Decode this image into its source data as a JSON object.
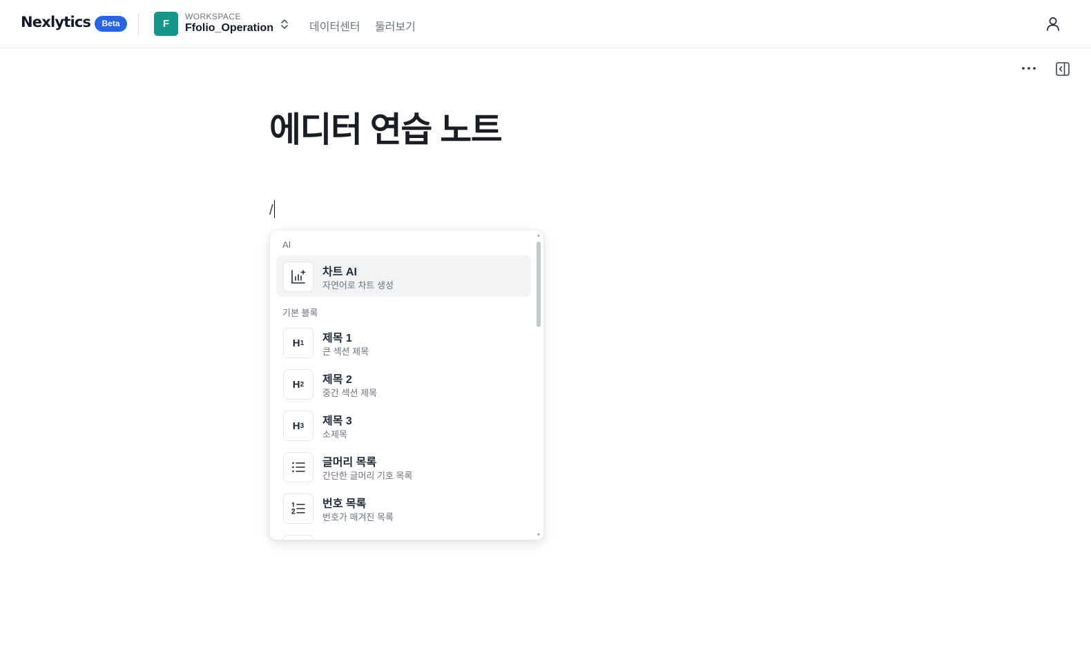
{
  "header": {
    "brand": "Nexlytics",
    "badge": "Beta",
    "workspace_initial": "F",
    "workspace_label": "WORKSPACE",
    "workspace_name": "Ffolio_Operation",
    "nav": [
      "데이터센터",
      "둘러보기"
    ]
  },
  "document": {
    "title": "에디터 연습 노트",
    "typed_text": "/"
  },
  "slash_menu": {
    "sections": [
      {
        "label": "AI",
        "items": [
          {
            "title": "차트 AI",
            "description": "자연어로 차트 생성",
            "icon": "chart-ai-icon"
          }
        ]
      },
      {
        "label": "기본 블록",
        "items": [
          {
            "title": "제목 1",
            "description": "큰 섹션 제목",
            "icon": "heading-1-icon",
            "icon_text": "H",
            "icon_sub": "1"
          },
          {
            "title": "제목 2",
            "description": "중간 섹션 제목",
            "icon": "heading-2-icon",
            "icon_text": "H",
            "icon_sub": "2"
          },
          {
            "title": "제목 3",
            "description": "소제목",
            "icon": "heading-3-icon",
            "icon_text": "H",
            "icon_sub": "3"
          },
          {
            "title": "글머리 목록",
            "description": "간단한 글머리 기호 목록",
            "icon": "bullet-list-icon"
          },
          {
            "title": "번호 목록",
            "description": "번호가 매겨진 목록",
            "icon": "numbered-list-icon"
          }
        ]
      }
    ],
    "active_item": "차트 AI"
  },
  "colors": {
    "accent": "#2563eb",
    "workspace": "#14968a",
    "menu_active_bg": "#f2f3f5"
  }
}
